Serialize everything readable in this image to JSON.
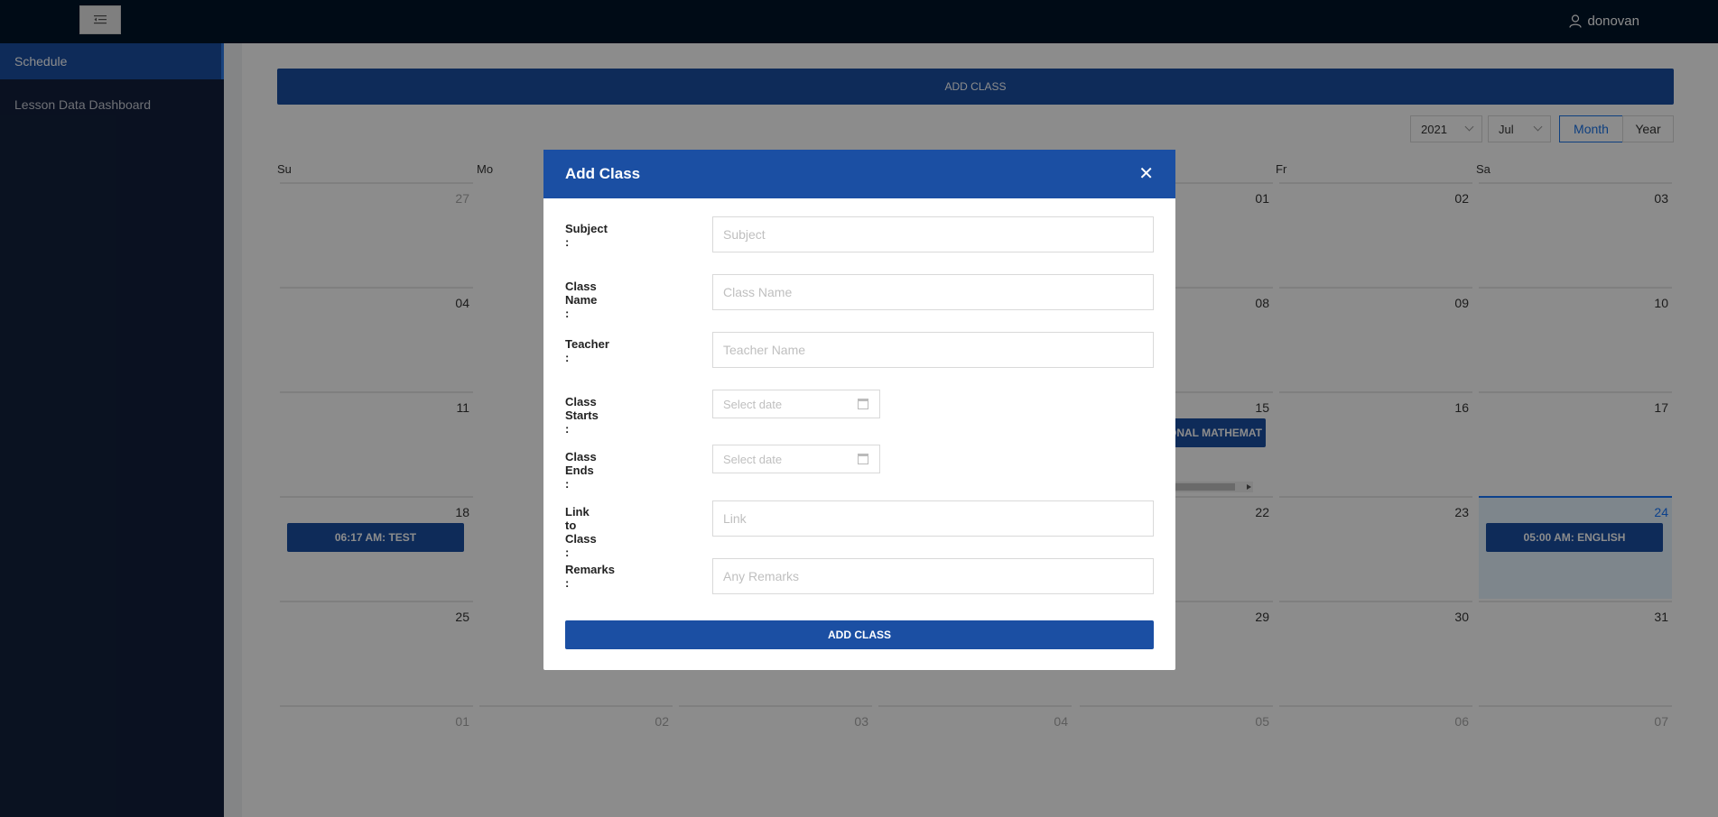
{
  "header": {
    "user_name": "donovan"
  },
  "sidebar": {
    "items": [
      {
        "label": "Schedule"
      },
      {
        "label": "Lesson Data Dashboard"
      }
    ]
  },
  "toolbar": {
    "add_class_label": "ADD CLASS",
    "year": "2021",
    "month": "Jul",
    "mode_month": "Month",
    "mode_year": "Year"
  },
  "calendar": {
    "weekdays": [
      "Su",
      "Mo",
      "Fr",
      "Sa"
    ],
    "days": [
      "27",
      "01",
      "02",
      "03",
      "04",
      "08",
      "09",
      "10",
      "11",
      "15",
      "16",
      "17",
      "18",
      "22",
      "23",
      "24",
      "25",
      "29",
      "30",
      "31",
      "01",
      "02",
      "03",
      "04",
      "05",
      "06",
      "07"
    ],
    "events": [
      "06:17 AM: TEST",
      "ONAL MATHEMAT",
      "05:00 AM: ENGLISH"
    ]
  },
  "modal": {
    "title": "Add Class",
    "close_symbol": "✕",
    "fields": {
      "subject": {
        "label": "Subject :",
        "placeholder": "Subject"
      },
      "class_name": {
        "label": "Class Name :",
        "placeholder": "Class Name"
      },
      "teacher": {
        "label": "Teacher :",
        "placeholder": "Teacher Name"
      },
      "class_starts": {
        "label": "Class Starts :",
        "placeholder": "Select date"
      },
      "class_ends": {
        "label": "Class Ends :",
        "placeholder": "Select date"
      },
      "link": {
        "label": "Link to Class :",
        "placeholder": "Link"
      },
      "remarks": {
        "label": "Remarks :",
        "placeholder": "Any Remarks"
      }
    },
    "submit_label": "ADD CLASS"
  },
  "colors": {
    "primary": "#1b4fa3",
    "header_bg": "#001529",
    "sidebar_bg": "#13203d",
    "today_bg": "#e6f4ff",
    "accent": "#1677ff"
  }
}
